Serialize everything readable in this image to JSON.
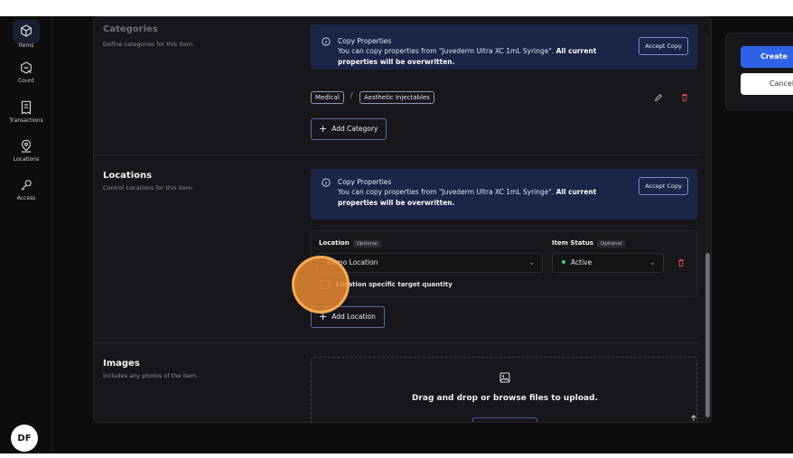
{
  "sidebar": {
    "items": [
      {
        "label": "Items",
        "icon": "cube-icon",
        "active": true
      },
      {
        "label": "Count",
        "icon": "scan-icon",
        "active": false
      },
      {
        "label": "Transactions",
        "icon": "receipt-icon",
        "active": false
      },
      {
        "label": "Locations",
        "icon": "map-pin-icon",
        "active": false
      },
      {
        "label": "Access",
        "icon": "key-icon",
        "active": false
      }
    ],
    "avatar_initials": "DF"
  },
  "categories": {
    "title": "Categories",
    "subtitle": "Define categories for this item.",
    "banner": {
      "title": "Copy Properties",
      "text_prefix": "You can copy properties from \"Juvederm Ultra XC 1mL Syringe\".",
      "text_bold": "All current properties will be overwritten.",
      "accept_label": "Accept Copy"
    },
    "chips": [
      "Medical",
      "Aesthetic Injectables"
    ],
    "separator": "/",
    "add_label": "Add Category"
  },
  "locations": {
    "title": "Locations",
    "subtitle": "Control Locations for this item.",
    "banner": {
      "title": "Copy Properties",
      "text_prefix": "You can copy properties from \"Juvederm Ultra XC 1mL Syringe\".",
      "text_bold": "All current properties will be overwritten.",
      "accept_label": "Accept Copy"
    },
    "location_label": "Location",
    "status_label": "Item Status",
    "optional_badge": "Optional",
    "location_value": "Demo Location",
    "status_value": "Active",
    "checkbox_label": "Location specific target quantity",
    "add_label": "Add Location"
  },
  "images": {
    "title": "Images",
    "subtitle": "Includes any photos of the item.",
    "drop_text": "Drag and drop or browse files to upload."
  },
  "actions": {
    "create_label": "Create",
    "cancel_label": "Cancel"
  },
  "colors": {
    "accent": "#2f62e6",
    "banner": "#1a2547",
    "status_active": "#3fcf6d",
    "delete": "#e5484d",
    "cursor": "#f08c32"
  }
}
